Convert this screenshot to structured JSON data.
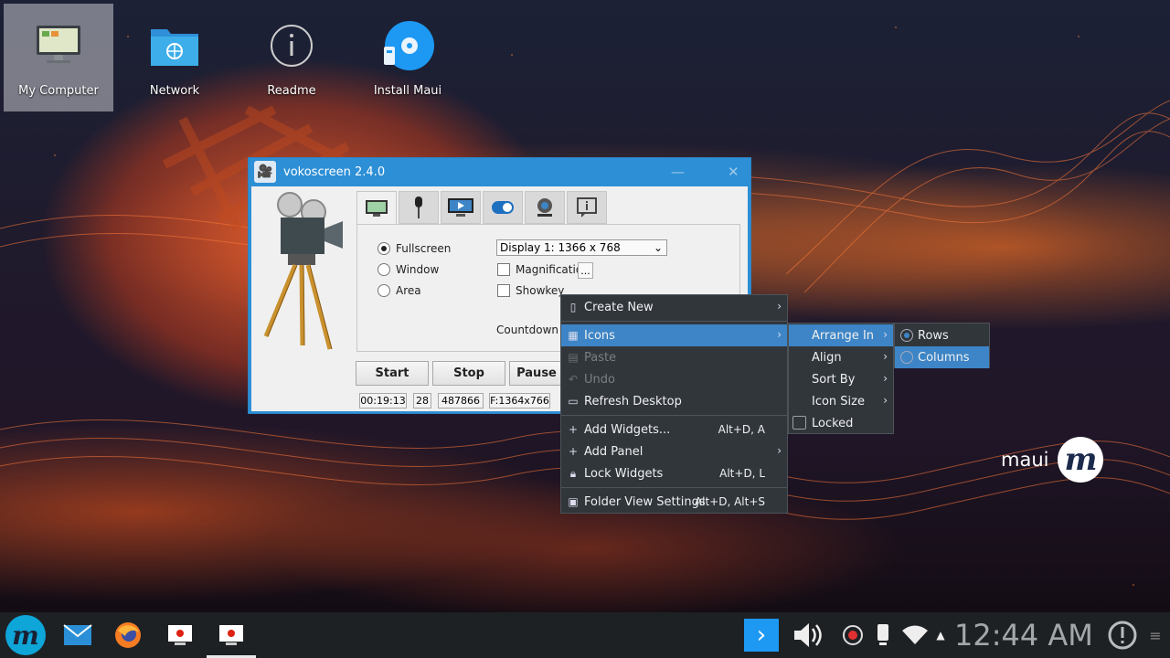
{
  "desktop": {
    "icons": [
      {
        "label": "My Computer",
        "icon": "computer-icon",
        "selected": true
      },
      {
        "label": "Network",
        "icon": "network-folder-icon"
      },
      {
        "label": "Readme",
        "icon": "info-icon"
      },
      {
        "label": "Install Maui",
        "icon": "install-disc-icon"
      }
    ],
    "brand": {
      "text": "maui",
      "glyph": "m"
    }
  },
  "vokoscreen": {
    "title": "vokoscreen 2.4.0",
    "tabs": [
      "screen-tab-icon",
      "microphone-tab-icon",
      "video-tab-icon",
      "toggle-tab-icon",
      "webcam-tab-icon",
      "info-tab-icon"
    ],
    "modes": {
      "fullscreen": "Fullscreen",
      "window": "Window",
      "area": "Area",
      "selected": "fullscreen"
    },
    "display_select": "Display 1:  1366 x 768",
    "magnification": "Magnification",
    "magnification_button": "...",
    "showkey": "Showkey",
    "countdown": "Countdown",
    "buttons": {
      "start": "Start",
      "stop": "Stop",
      "pause": "Pause"
    },
    "status": {
      "time": "00:19:13",
      "fps": "28",
      "size": "487866",
      "format": "F:1364x766"
    }
  },
  "context_menu": {
    "items": [
      {
        "label": "Create New",
        "icon": "new-document-icon",
        "submenu": true
      },
      {
        "label": "Icons",
        "icon": "icons-grid-icon",
        "submenu": true,
        "highlighted": true
      },
      {
        "label": "Paste",
        "icon": "paste-icon",
        "disabled": true
      },
      {
        "label": "Undo",
        "icon": "undo-icon",
        "disabled": true
      },
      {
        "label": "Refresh Desktop",
        "icon": "refresh-desktop-icon"
      },
      {
        "label": "Add Widgets...",
        "icon": "plus-icon",
        "shortcut": "Alt+D, A"
      },
      {
        "label": "Add Panel",
        "icon": "plus-icon",
        "submenu": true
      },
      {
        "label": "Lock Widgets",
        "icon": "lock-icon",
        "shortcut": "Alt+D, L"
      },
      {
        "label": "Folder View Settings",
        "icon": "settings-icon",
        "shortcut": "Alt+D, Alt+S"
      }
    ]
  },
  "icons_submenu": {
    "items": [
      {
        "label": "Arrange In",
        "submenu": true,
        "highlighted": true
      },
      {
        "label": "Align",
        "submenu": true
      },
      {
        "label": "Sort By",
        "submenu": true
      },
      {
        "label": "Icon Size",
        "submenu": true
      },
      {
        "label": "Locked",
        "checkbox": true,
        "checked": false
      }
    ]
  },
  "arrange_submenu": {
    "items": [
      {
        "label": "Rows",
        "selected": true
      },
      {
        "label": "Columns",
        "highlighted": true
      }
    ]
  },
  "taskbar": {
    "launchers": [
      "maui-launcher-icon",
      "mail-icon",
      "firefox-icon",
      "vokoscreen-task-icon",
      "vokoscreen-task-icon"
    ],
    "tray": [
      "expand-tray-icon",
      "volume-icon",
      "record-icon",
      "device-icon",
      "wifi-icon",
      "up-arrow-icon"
    ],
    "clock": "12:44 AM",
    "notifications": "notification-icon",
    "menu": "panel-menu-icon"
  },
  "colors": {
    "accent": "#3d85c6",
    "window_title": "#2d8fd6",
    "menu_bg": "#31363b",
    "taskbar_bg": "#1e2124"
  }
}
